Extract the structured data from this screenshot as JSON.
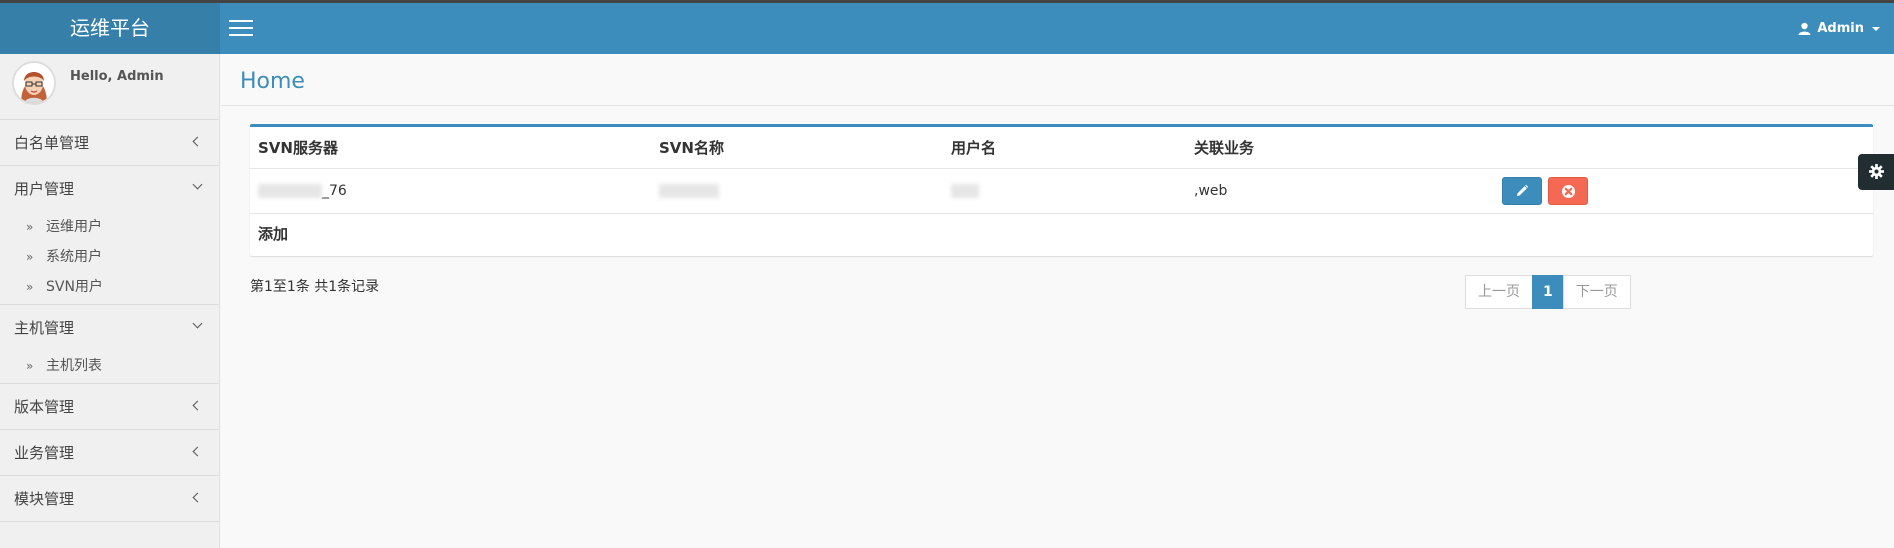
{
  "app": {
    "brand": "运维平台",
    "user_menu_label": "Admin"
  },
  "sidebar": {
    "greeting": "Hello, Admin",
    "items": [
      {
        "label": "白名单管理",
        "expanded": false,
        "children": []
      },
      {
        "label": "用户管理",
        "expanded": true,
        "children": [
          "运维用户",
          "系统用户",
          "SVN用户"
        ]
      },
      {
        "label": "主机管理",
        "expanded": true,
        "children": [
          "主机列表"
        ]
      },
      {
        "label": "版本管理",
        "expanded": false,
        "children": []
      },
      {
        "label": "业务管理",
        "expanded": false,
        "children": []
      },
      {
        "label": "模块管理",
        "expanded": false,
        "children": []
      }
    ]
  },
  "page": {
    "title": "Home"
  },
  "table": {
    "columns": [
      "SVN服务器",
      "SVN名称",
      "用户名",
      "关联业务",
      ""
    ],
    "rows": [
      {
        "svn_server": "_76",
        "svn_name": "",
        "username": "",
        "business": ",web"
      }
    ],
    "add_label": "添加"
  },
  "pagination": {
    "info": "第1至1条 共1条记录",
    "prev": "上一页",
    "current": "1",
    "next": "下一页"
  },
  "colors": {
    "primary": "#3c8dbc",
    "danger": "#f56954",
    "brand_bg": "#367fa9"
  },
  "icons": [
    "menu-icon",
    "user-icon",
    "pencil-icon",
    "times-circle-icon",
    "gear-icon",
    "double-chevron-right-icon"
  ]
}
